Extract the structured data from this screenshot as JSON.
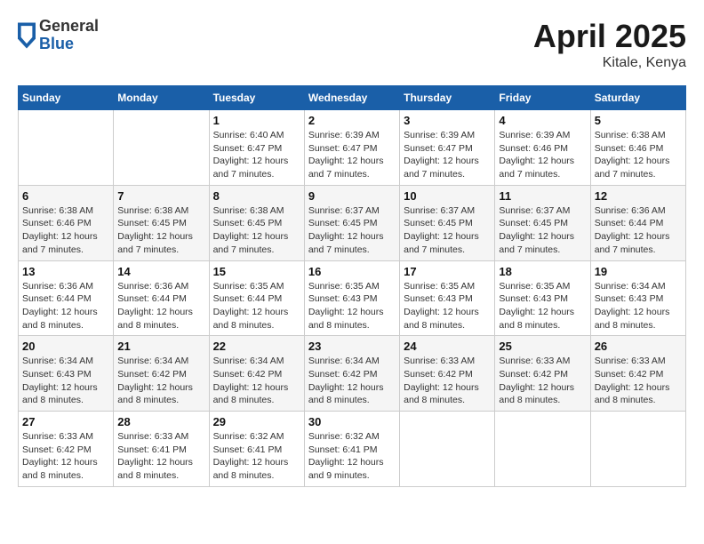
{
  "header": {
    "logo_general": "General",
    "logo_blue": "Blue",
    "month_title": "April 2025",
    "location": "Kitale, Kenya"
  },
  "calendar": {
    "days_of_week": [
      "Sunday",
      "Monday",
      "Tuesday",
      "Wednesday",
      "Thursday",
      "Friday",
      "Saturday"
    ],
    "weeks": [
      [
        {
          "day": "",
          "info": ""
        },
        {
          "day": "",
          "info": ""
        },
        {
          "day": "1",
          "info": "Sunrise: 6:40 AM\nSunset: 6:47 PM\nDaylight: 12 hours and 7 minutes."
        },
        {
          "day": "2",
          "info": "Sunrise: 6:39 AM\nSunset: 6:47 PM\nDaylight: 12 hours and 7 minutes."
        },
        {
          "day": "3",
          "info": "Sunrise: 6:39 AM\nSunset: 6:47 PM\nDaylight: 12 hours and 7 minutes."
        },
        {
          "day": "4",
          "info": "Sunrise: 6:39 AM\nSunset: 6:46 PM\nDaylight: 12 hours and 7 minutes."
        },
        {
          "day": "5",
          "info": "Sunrise: 6:38 AM\nSunset: 6:46 PM\nDaylight: 12 hours and 7 minutes."
        }
      ],
      [
        {
          "day": "6",
          "info": "Sunrise: 6:38 AM\nSunset: 6:46 PM\nDaylight: 12 hours and 7 minutes."
        },
        {
          "day": "7",
          "info": "Sunrise: 6:38 AM\nSunset: 6:45 PM\nDaylight: 12 hours and 7 minutes."
        },
        {
          "day": "8",
          "info": "Sunrise: 6:38 AM\nSunset: 6:45 PM\nDaylight: 12 hours and 7 minutes."
        },
        {
          "day": "9",
          "info": "Sunrise: 6:37 AM\nSunset: 6:45 PM\nDaylight: 12 hours and 7 minutes."
        },
        {
          "day": "10",
          "info": "Sunrise: 6:37 AM\nSunset: 6:45 PM\nDaylight: 12 hours and 7 minutes."
        },
        {
          "day": "11",
          "info": "Sunrise: 6:37 AM\nSunset: 6:45 PM\nDaylight: 12 hours and 7 minutes."
        },
        {
          "day": "12",
          "info": "Sunrise: 6:36 AM\nSunset: 6:44 PM\nDaylight: 12 hours and 7 minutes."
        }
      ],
      [
        {
          "day": "13",
          "info": "Sunrise: 6:36 AM\nSunset: 6:44 PM\nDaylight: 12 hours and 8 minutes."
        },
        {
          "day": "14",
          "info": "Sunrise: 6:36 AM\nSunset: 6:44 PM\nDaylight: 12 hours and 8 minutes."
        },
        {
          "day": "15",
          "info": "Sunrise: 6:35 AM\nSunset: 6:44 PM\nDaylight: 12 hours and 8 minutes."
        },
        {
          "day": "16",
          "info": "Sunrise: 6:35 AM\nSunset: 6:43 PM\nDaylight: 12 hours and 8 minutes."
        },
        {
          "day": "17",
          "info": "Sunrise: 6:35 AM\nSunset: 6:43 PM\nDaylight: 12 hours and 8 minutes."
        },
        {
          "day": "18",
          "info": "Sunrise: 6:35 AM\nSunset: 6:43 PM\nDaylight: 12 hours and 8 minutes."
        },
        {
          "day": "19",
          "info": "Sunrise: 6:34 AM\nSunset: 6:43 PM\nDaylight: 12 hours and 8 minutes."
        }
      ],
      [
        {
          "day": "20",
          "info": "Sunrise: 6:34 AM\nSunset: 6:43 PM\nDaylight: 12 hours and 8 minutes."
        },
        {
          "day": "21",
          "info": "Sunrise: 6:34 AM\nSunset: 6:42 PM\nDaylight: 12 hours and 8 minutes."
        },
        {
          "day": "22",
          "info": "Sunrise: 6:34 AM\nSunset: 6:42 PM\nDaylight: 12 hours and 8 minutes."
        },
        {
          "day": "23",
          "info": "Sunrise: 6:34 AM\nSunset: 6:42 PM\nDaylight: 12 hours and 8 minutes."
        },
        {
          "day": "24",
          "info": "Sunrise: 6:33 AM\nSunset: 6:42 PM\nDaylight: 12 hours and 8 minutes."
        },
        {
          "day": "25",
          "info": "Sunrise: 6:33 AM\nSunset: 6:42 PM\nDaylight: 12 hours and 8 minutes."
        },
        {
          "day": "26",
          "info": "Sunrise: 6:33 AM\nSunset: 6:42 PM\nDaylight: 12 hours and 8 minutes."
        }
      ],
      [
        {
          "day": "27",
          "info": "Sunrise: 6:33 AM\nSunset: 6:42 PM\nDaylight: 12 hours and 8 minutes."
        },
        {
          "day": "28",
          "info": "Sunrise: 6:33 AM\nSunset: 6:41 PM\nDaylight: 12 hours and 8 minutes."
        },
        {
          "day": "29",
          "info": "Sunrise: 6:32 AM\nSunset: 6:41 PM\nDaylight: 12 hours and 8 minutes."
        },
        {
          "day": "30",
          "info": "Sunrise: 6:32 AM\nSunset: 6:41 PM\nDaylight: 12 hours and 9 minutes."
        },
        {
          "day": "",
          "info": ""
        },
        {
          "day": "",
          "info": ""
        },
        {
          "day": "",
          "info": ""
        }
      ]
    ]
  }
}
